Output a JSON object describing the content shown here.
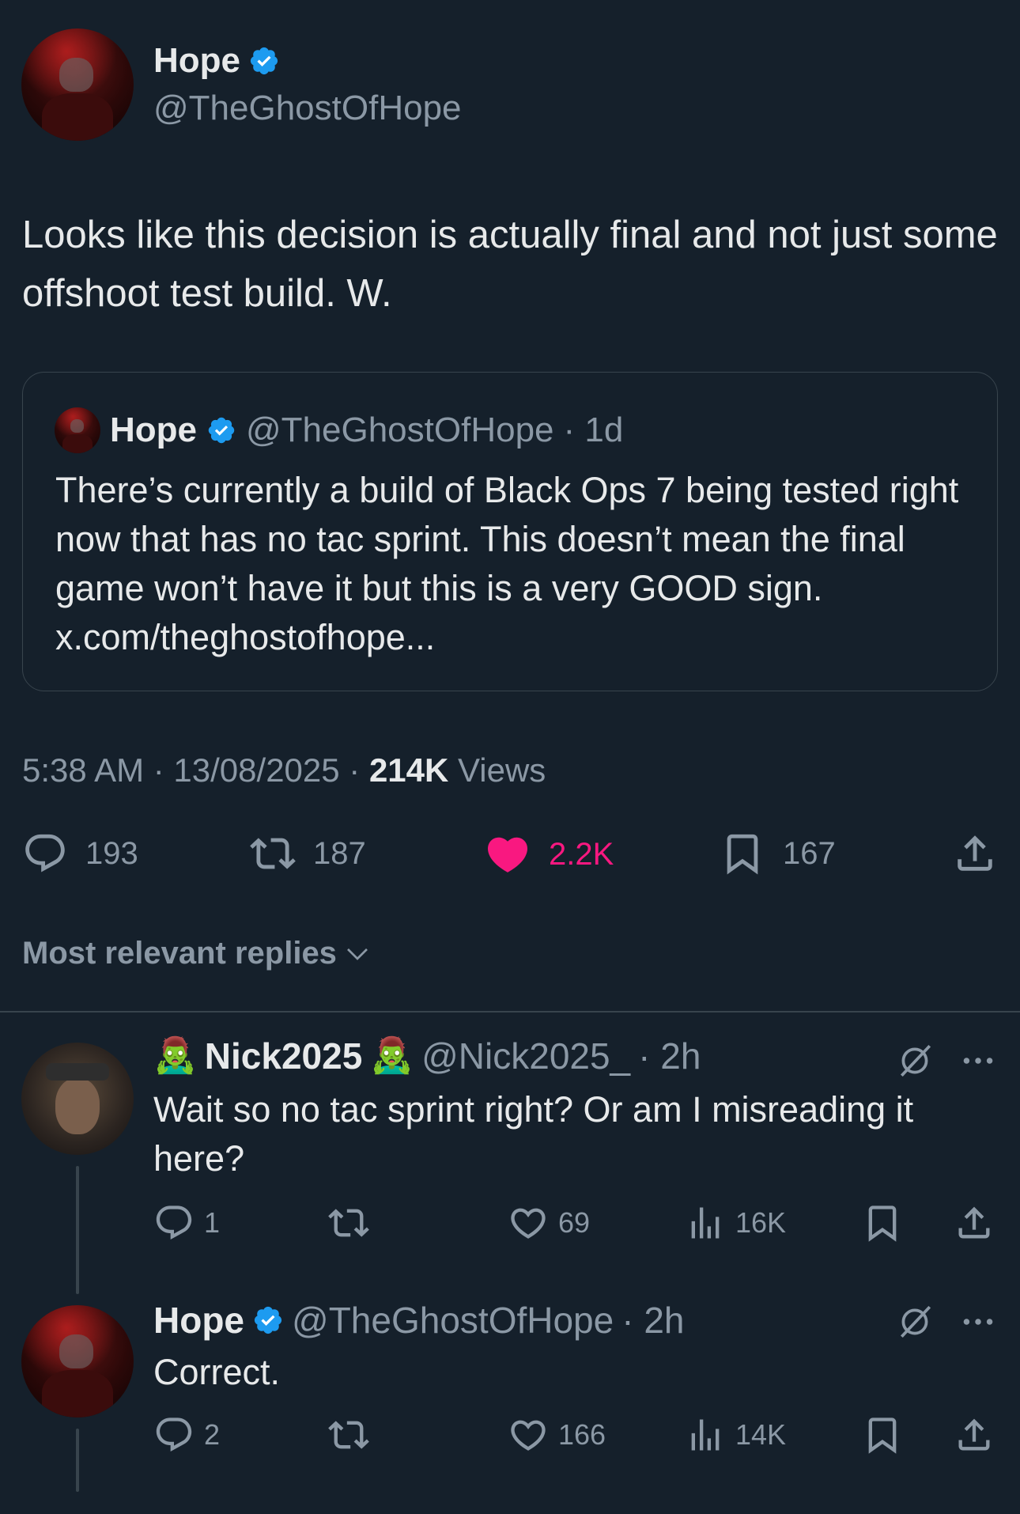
{
  "tweet": {
    "author": {
      "name": "Hope",
      "handle": "@TheGhostOfHope",
      "verified": true
    },
    "text": "Looks like this decision is actually final and not just some offshoot test build. W.",
    "quote": {
      "name": "Hope",
      "handle": "@TheGhostOfHope",
      "age": "· 1d",
      "text": "There’s currently a build of Black Ops 7 being tested right now that has no tac sprint. This doesn’t mean the final game won’t have it but this is a very GOOD sign. x.com/theghostofhope..."
    },
    "time": "5:38 AM · 13/08/2025 · ",
    "views_count": "214K",
    "views_label": " Views",
    "stats": {
      "replies": "193",
      "reposts": "187",
      "likes": "2.2K",
      "bookmarks": "167"
    },
    "colors": {
      "like": "#f91880",
      "verified": "#1d9bf0"
    }
  },
  "sort_label": "Most relevant replies",
  "replies": [
    {
      "name": "Nick2025",
      "handle": "@Nick2025_",
      "age": "· 2h",
      "emoji_before": "🧟‍♂️",
      "emoji_after": "🧟‍♂️",
      "text": "Wait so no tac sprint right? Or am I misreading it here?",
      "replies": "1",
      "likes": "69",
      "views": "16K"
    },
    {
      "name": "Hope",
      "handle": "@TheGhostOfHope",
      "age": "· 2h",
      "verified": true,
      "text": "Correct.",
      "replies": "2",
      "likes": "166",
      "views": "14K"
    }
  ]
}
